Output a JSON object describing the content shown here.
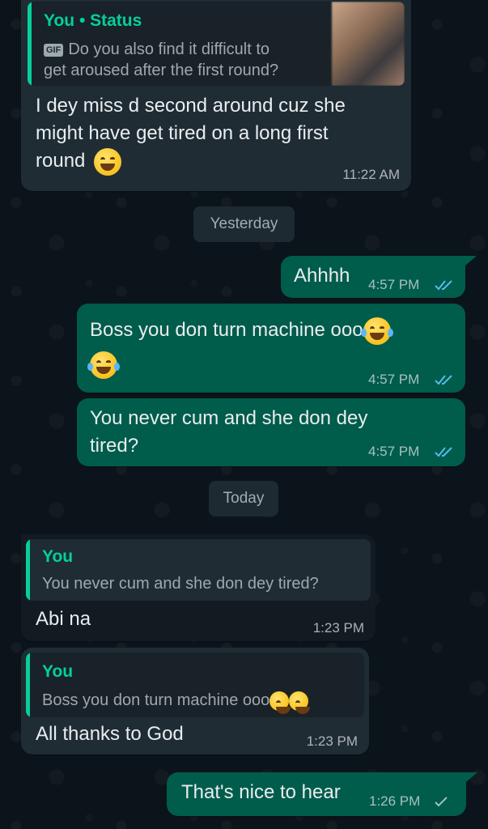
{
  "messages": [
    {
      "quote_author": "You • Status",
      "quote_badge": "GIF",
      "quote_line1": "Do you also find it difficult to",
      "quote_line2": "get aroused after the first round?",
      "line1": "I dey miss d second around cuz she",
      "line2": "might have get tired on a long first",
      "line3": "round",
      "time": "11:22 AM"
    },
    {
      "date": "Yesterday"
    },
    {
      "text": "Ahhhh",
      "time": "4:57 PM"
    },
    {
      "line1": "Boss you don turn machine ooo",
      "time": "4:57 PM"
    },
    {
      "line1": "You never cum and she don dey",
      "line2": "tired?",
      "time": "4:57 PM"
    },
    {
      "date": "Today"
    },
    {
      "quote_author": "You",
      "quote_text": "You never cum and she don dey tired?",
      "text": "Abi na",
      "time": "1:23 PM"
    },
    {
      "quote_author": "You",
      "quote_text": "Boss you don turn machine ooo",
      "text": "All thanks to God",
      "time": "1:23 PM"
    },
    {
      "text": "That's nice to hear",
      "time": "1:26 PM"
    }
  ],
  "icons": {
    "read": "double-check-icon",
    "sent": "single-check-icon",
    "emoji": "tears-of-joy-emoji"
  },
  "colors": {
    "background": "#0b141a",
    "incoming": "#1f2c34",
    "outgoing": "#005c4b",
    "accent": "#06cf9c",
    "read_ticks": "#53bdeb"
  }
}
